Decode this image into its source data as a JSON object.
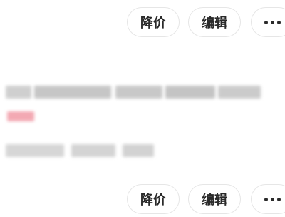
{
  "top_actions": {
    "price_label": "降价",
    "edit_label": "编辑",
    "more_icon": "more-horizontal-icon"
  },
  "bottom_actions": {
    "price_label": "降价",
    "edit_label": "编辑",
    "more_icon": "more-horizontal-icon"
  },
  "colors": {
    "tag_accent": "#f3a9b3",
    "button_border": "#e6e6e6",
    "button_text": "#2a2a2a"
  }
}
